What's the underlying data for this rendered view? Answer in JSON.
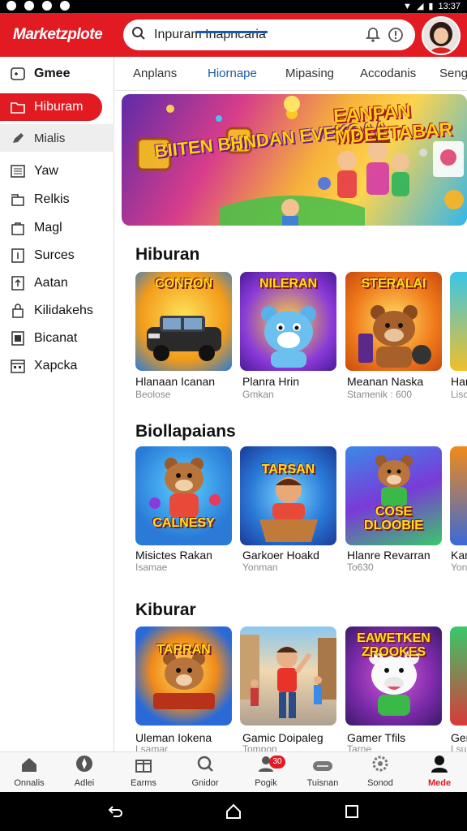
{
  "status": {
    "time": "13:37"
  },
  "header": {
    "logo": "Marketzplote",
    "search_value": "Inpuram Inapncaria"
  },
  "sidebar": {
    "items": [
      {
        "label": "Gmee",
        "icon": "gamepad-icon"
      },
      {
        "label": "Hiburam",
        "icon": "folder-icon"
      },
      {
        "label": "Mialis",
        "icon": "pencil-icon"
      },
      {
        "label": "Yaw",
        "icon": "list-icon"
      },
      {
        "label": "Relkis",
        "icon": "box-icon"
      },
      {
        "label": "Magl",
        "icon": "bag-icon"
      },
      {
        "label": "Surces",
        "icon": "tile-icon"
      },
      {
        "label": "Aatan",
        "icon": "upload-icon"
      },
      {
        "label": "Kilidakehs",
        "icon": "lock-icon"
      },
      {
        "label": "Bicanat",
        "icon": "store-icon"
      },
      {
        "label": "Xapcka",
        "icon": "calendar-icon"
      }
    ]
  },
  "tabs": [
    {
      "label": "Anplans"
    },
    {
      "label": "Hiornape"
    },
    {
      "label": "Mipasing"
    },
    {
      "label": "Accodanis"
    },
    {
      "label": "Sengr"
    }
  ],
  "banner": {
    "left_text": "BIITEN BHNDAN EVEKOAA",
    "right_text": "EANPAN MDEETABAR"
  },
  "sections": [
    {
      "title": "Hiburan",
      "games": [
        {
          "art": "CONRON",
          "name": "Hlanaan Icanan",
          "sub": "Beolose"
        },
        {
          "art": "NILERAN",
          "name": "Planra Hrin",
          "sub": "Gmkan"
        },
        {
          "art": "STERALAI",
          "name": "Meanan Naska",
          "sub": "Stamenik : 600"
        },
        {
          "art": "",
          "name": "Har",
          "sub": "Lisc"
        }
      ]
    },
    {
      "title": "Biollapaians",
      "games": [
        {
          "art": "CALNESY",
          "name": "Misictes Rakan",
          "sub": "Isamae"
        },
        {
          "art": "TARSAN",
          "name": "Garkoer Hoakd",
          "sub": "Yonman"
        },
        {
          "art": "COSE DLOOBIE",
          "name": "Hlanre Revarran",
          "sub": "To630"
        },
        {
          "art": "",
          "name": "Kar",
          "sub": "Yon"
        }
      ]
    },
    {
      "title": "Kiburar",
      "games": [
        {
          "art": "TARRAN",
          "name": "Uleman Iokena",
          "sub": "Lsamar"
        },
        {
          "art": "",
          "name": "Gamic Doipaleg",
          "sub": "Tompon"
        },
        {
          "art": "EAWETKEN ZROOKES",
          "name": "Gamer Tfils",
          "sub": "Tarne"
        },
        {
          "art": "",
          "name": "Ger",
          "sub": "Lsu"
        }
      ]
    }
  ],
  "bottom_nav": [
    {
      "label": "Onnalis",
      "icon": "home-icon"
    },
    {
      "label": "Adlei",
      "icon": "compass-icon"
    },
    {
      "label": "Earms",
      "icon": "box-icon"
    },
    {
      "label": "Gnidor",
      "icon": "search-icon"
    },
    {
      "label": "Pogik",
      "icon": "person-icon",
      "badge": "30"
    },
    {
      "label": "Tuisnan",
      "icon": "cloud-icon"
    },
    {
      "label": "Sonod",
      "icon": "gear-icon"
    },
    {
      "label": "Mede",
      "icon": "profile-icon"
    }
  ],
  "colors": {
    "brand": "#e21b23",
    "accent": "#1c5aa8"
  }
}
